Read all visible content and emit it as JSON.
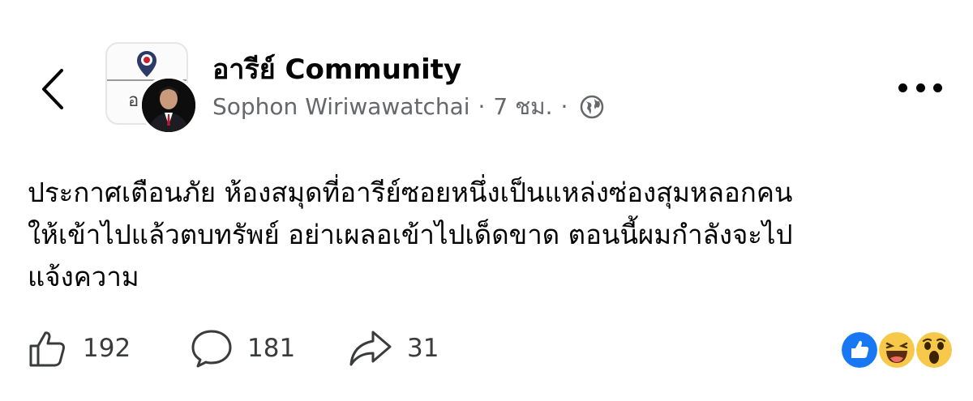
{
  "header": {
    "group_name": "อารีย์ Community",
    "author": "Sophon Wiriwawatchai",
    "separator": "·",
    "time": "7 ชม.",
    "visibility_icon": "globe-icon",
    "group_avatar_text": "อา",
    "back_icon": "chevron-left-icon",
    "more_icon": "ellipsis-icon"
  },
  "post": {
    "lines": [
      "ประกาศเตือนภัย ห้องสมุดที่อารีย์ซอยหนึ่งเป็นแหล่งซ่องสุมหลอกคน",
      "ให้เข้าไปแล้วตบทรัพย์ อย่าเผลอเข้าไปเด็ดขาด ตอนนี้ผมกำลังจะไป",
      "แจ้งความ"
    ]
  },
  "actions": {
    "like_count": "192",
    "comment_count": "181",
    "share_count": "31"
  },
  "reactions": [
    "like",
    "haha",
    "wow"
  ],
  "colors": {
    "like_blue": "#1877f2",
    "emoji_yellow": "#f7c94a",
    "meta_gray": "#65676b"
  }
}
